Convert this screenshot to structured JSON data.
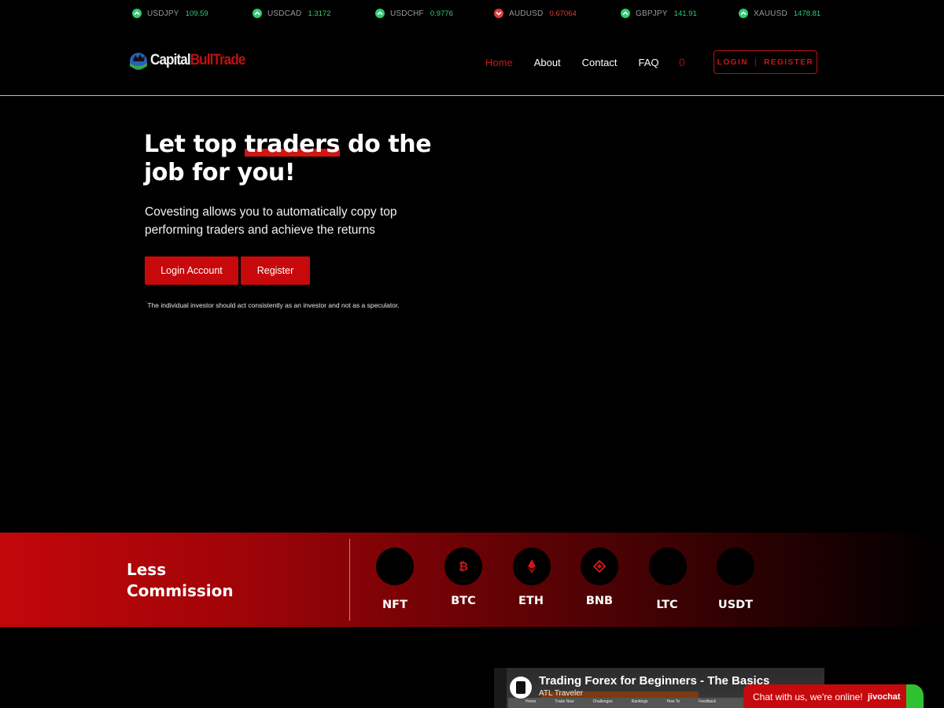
{
  "ticker": [
    {
      "symbol": "USDJPY",
      "value": "109.59",
      "direction": "up"
    },
    {
      "symbol": "USDCAD",
      "value": "1.3172",
      "direction": "up"
    },
    {
      "symbol": "USDCHF",
      "value": "0.9776",
      "direction": "up"
    },
    {
      "symbol": "AUDUSD",
      "value": "0.67064",
      "direction": "down"
    },
    {
      "symbol": "GBPJPY",
      "value": "141.91",
      "direction": "up"
    },
    {
      "symbol": "XAUUSD",
      "value": "1478.81",
      "direction": "up"
    }
  ],
  "brand": {
    "part1": "Capital",
    "part2": "BullTrade"
  },
  "nav": {
    "home": "Home",
    "about": "About",
    "contact": "Contact",
    "faq": "FAQ",
    "cart_count": "0"
  },
  "auth": {
    "login": "LOGIN",
    "separator": "|",
    "register": "REGISTER"
  },
  "hero": {
    "title_before": "Let top ",
    "title_highlight": "traders",
    "title_after": " do the job for you!",
    "subtitle": "Covesting allows you to automatically copy top performing traders and achieve the returns",
    "login_button": "Login Account",
    "register_button": "Register",
    "note": "The individual investor should act consistently as an investor and not as a speculator."
  },
  "band": {
    "title_line1": "Less",
    "title_line2": "Commission",
    "coins": [
      {
        "label": "NFT",
        "icon": "nft-icon"
      },
      {
        "label": "BTC",
        "icon": "bitcoin-icon"
      },
      {
        "label": "ETH",
        "icon": "ethereum-icon"
      },
      {
        "label": "BNB",
        "icon": "bnb-icon"
      },
      {
        "label": "LTC",
        "icon": "litecoin-icon"
      },
      {
        "label": "USDT",
        "icon": "tether-icon"
      }
    ]
  },
  "video": {
    "title": "Trading Forex for Beginners - The Basics",
    "channel": "ATL Traveler",
    "nav": [
      "Home",
      "Trade Now",
      "Challenges",
      "Rankings",
      "How To",
      "Feedback"
    ]
  },
  "chat": {
    "text": "Chat with us, we're online!",
    "brand": "jivochat"
  },
  "colors": {
    "accent": "#c8090c",
    "up": "#2ecc71",
    "down": "#e23b3b"
  }
}
